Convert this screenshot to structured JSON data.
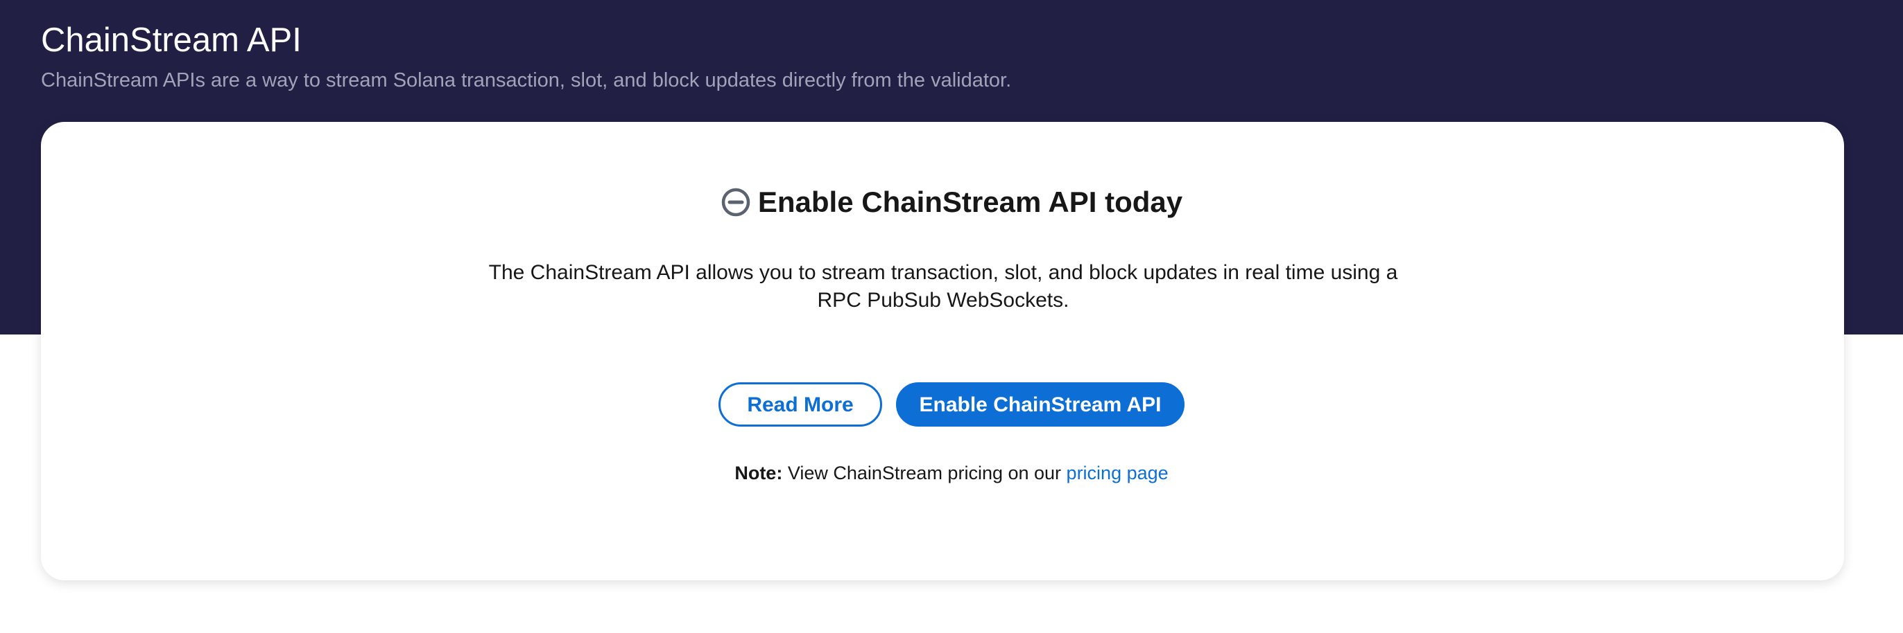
{
  "header": {
    "title": "ChainStream API",
    "subtitle": "ChainStream APIs are a way to stream Solana transaction, slot, and block updates directly from the validator."
  },
  "card": {
    "icon": "minus-circle-icon",
    "title": "Enable ChainStream API today",
    "description": "The ChainStream API allows you to stream transaction, slot, and block updates in real time using a RPC PubSub WebSockets.",
    "read_more_label": "Read More",
    "enable_label": "Enable ChainStream API",
    "note_label": "Note:",
    "note_text": " View ChainStream pricing on our ",
    "note_link": "pricing page"
  },
  "colors": {
    "header_background": "#211f44",
    "accent": "#0d6fd6",
    "subtitle": "#a3a2b8",
    "icon": "#5b6370"
  }
}
